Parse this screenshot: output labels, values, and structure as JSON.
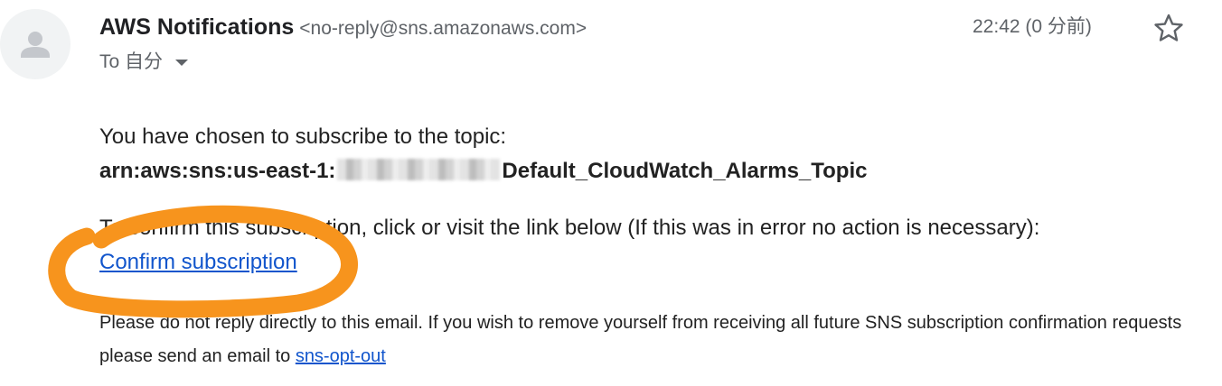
{
  "sender": {
    "name": "AWS Notifications",
    "email": "<no-reply@sns.amazonaws.com>"
  },
  "recipient": {
    "label": "To 自分"
  },
  "timestamp": "22:42 (0 分前)",
  "icons": {
    "avatar": "person-icon",
    "star": "star-icon",
    "dropdown": "chevron-down-icon"
  },
  "body": {
    "line1": "You have chosen to subscribe to the topic:",
    "topic_prefix": "arn:aws:sns:us-east-1:",
    "topic_suffix": "Default_CloudWatch_Alarms_Topic",
    "line3": "To confirm this subscription, click or visit the link below (If this was in error no action is necessary):",
    "confirm_link": "Confirm subscription",
    "line5": "Please do not reply directly to this email. If you wish to remove yourself from receiving all future SNS subscription confirmation requests",
    "line6_prefix": "please send an email to ",
    "opt_out_link": "sns-opt-out"
  },
  "colors": {
    "link": "#1155cc",
    "annotation": "#f7941d",
    "secondary_text": "#5f6368"
  }
}
